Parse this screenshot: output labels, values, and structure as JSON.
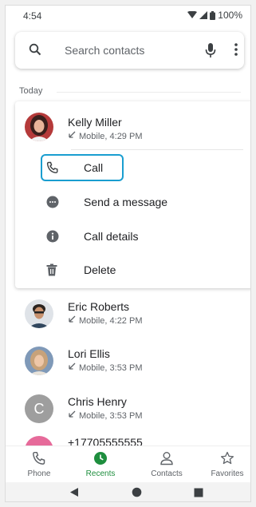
{
  "status_bar": {
    "time": "4:54",
    "battery": "100%"
  },
  "search": {
    "placeholder": "Search contacts"
  },
  "section": {
    "today": "Today"
  },
  "expanded_contact": {
    "name": "Kelly Miller",
    "detail": "Mobile, 4:29 PM",
    "actions": [
      {
        "label": "Call",
        "icon": "phone-icon"
      },
      {
        "label": "Send a message",
        "icon": "message-icon"
      },
      {
        "label": "Call details",
        "icon": "info-icon"
      },
      {
        "label": "Delete",
        "icon": "trash-icon"
      }
    ]
  },
  "recents": [
    {
      "name": "Eric Roberts",
      "detail": "Mobile, 4:22 PM"
    },
    {
      "name": "Lori Ellis",
      "detail": "Mobile, 3:53 PM"
    },
    {
      "name": "Chris Henry",
      "detail": "Mobile, 3:53 PM",
      "initial": "C"
    },
    {
      "name": "+17705555555"
    }
  ],
  "bottom_nav": [
    {
      "label": "Phone",
      "icon": "phone-icon"
    },
    {
      "label": "Recents",
      "icon": "clock-icon",
      "active": true
    },
    {
      "label": "Contacts",
      "icon": "person-icon"
    },
    {
      "label": "Favorites",
      "icon": "star-icon"
    }
  ],
  "colors": {
    "accent_green": "#1e8e3e",
    "focus_blue": "#1a9ed0",
    "avatar_pink": "#e66a9a"
  }
}
